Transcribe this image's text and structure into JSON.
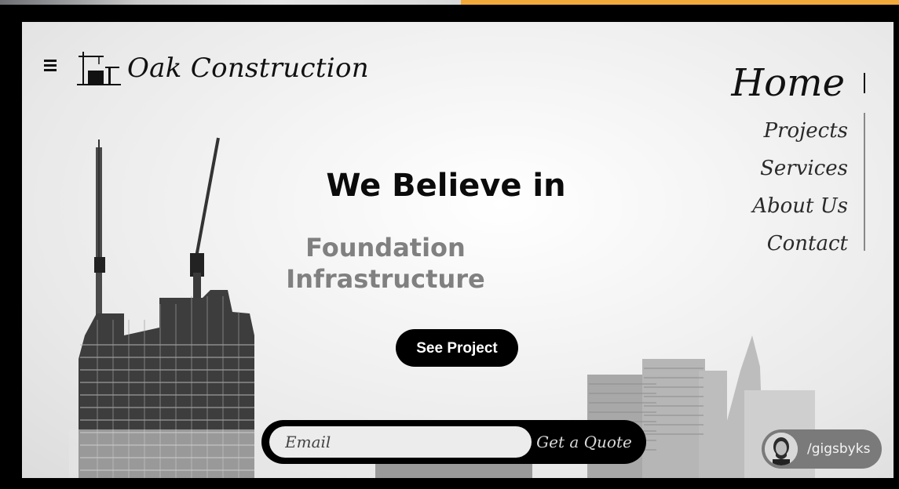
{
  "brand": {
    "name": "Oak Construction"
  },
  "nav": {
    "active": "Home",
    "items": [
      "Projects",
      "Services",
      "About Us",
      "Contact"
    ]
  },
  "hero": {
    "title": "We Believe in",
    "subtitle_line1": "Foundation",
    "subtitle_line2": "Infrastructure",
    "cta": "See Project"
  },
  "quote": {
    "email_placeholder": "Email",
    "button": "Get a Quote"
  },
  "creator": {
    "handle": "/gigsbyks"
  },
  "icons": {
    "menu": "hamburger-icon",
    "logo": "crane-building-icon",
    "avatar": "avatar"
  },
  "colors": {
    "accent_strip": "#f2a93b",
    "cta_bg": "#000000",
    "subtitle": "#808080"
  }
}
